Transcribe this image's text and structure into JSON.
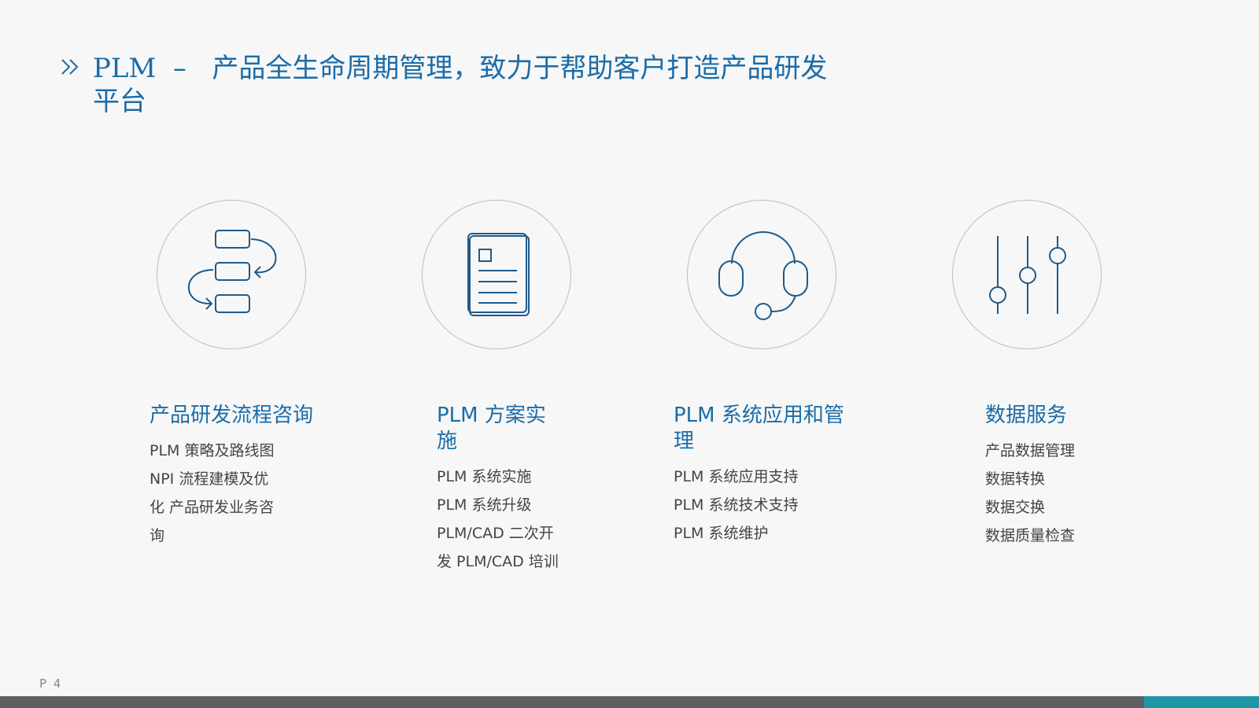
{
  "title": {
    "code": "PLM",
    "dash": "–",
    "text": "产品全生命周期管理，致力于帮助客户打造产品研发平台"
  },
  "services": [
    {
      "icon": "workflow-icon",
      "heading": "产品研发流程咨询",
      "lines": [
        "PLM 策略及路线图",
        "NPI 流程建模及优",
        "化 产品研发业务咨",
        "询"
      ]
    },
    {
      "icon": "document-icon",
      "heading": "PLM 方案实施",
      "lines": [
        "PLM 系统实施",
        "PLM 系统升级",
        "PLM/CAD 二次开",
        "发 PLM/CAD 培训"
      ]
    },
    {
      "icon": "headset-icon",
      "heading": "PLM 系统应用和管理",
      "lines": [
        "PLM 系统应用支持",
        "PLM 系统技术支持",
        "PLM 系统维护"
      ]
    },
    {
      "icon": "sliders-icon",
      "heading": "数据服务",
      "lines": [
        "产品数据管理",
        "数据转换",
        "数据交换",
        "数据质量检查"
      ]
    }
  ],
  "footer": {
    "page": "P 4"
  },
  "colors": {
    "accent": "#1a6ca8",
    "icon": "#1e5a8a",
    "footer_bar": "#5d6063",
    "footer_accent": "#1d96a6"
  }
}
